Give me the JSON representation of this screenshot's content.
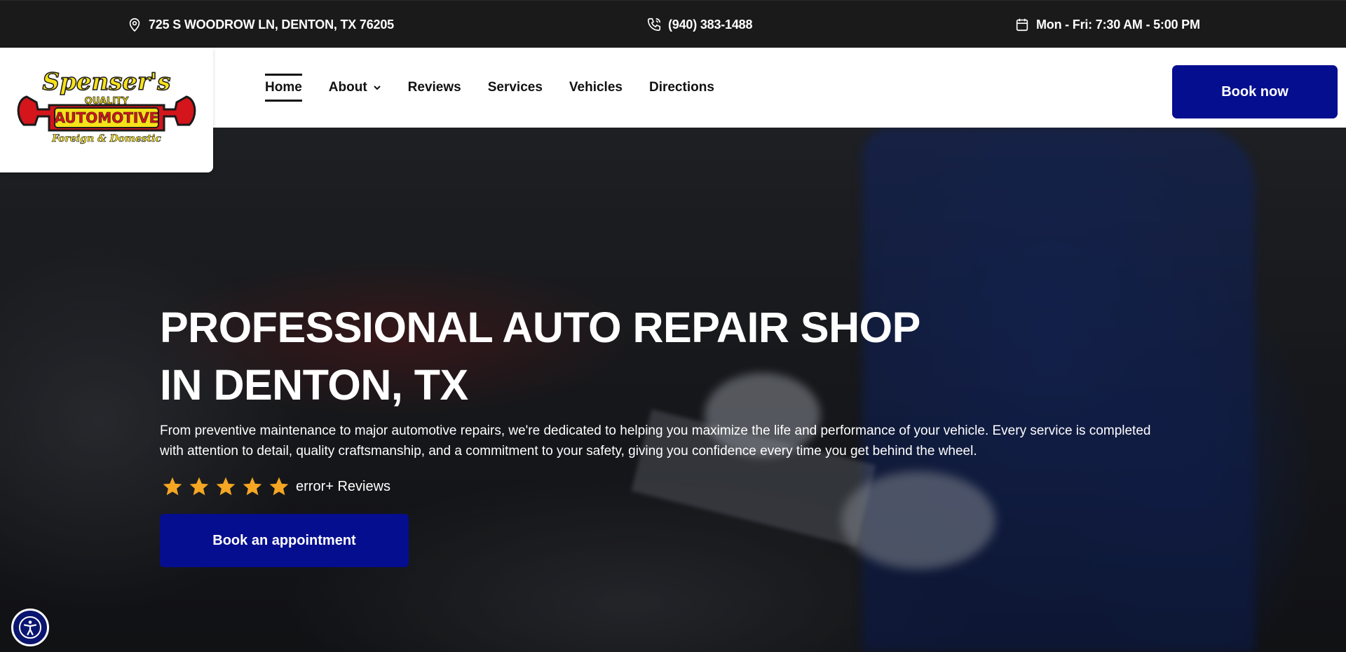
{
  "topbar": {
    "address": "725 S WOODROW LN, DENTON, TX 76205",
    "phone": "(940) 383-1488",
    "hours": "Mon - Fri: 7:30 AM - 5:00 PM"
  },
  "logo": {
    "line1": "Spenser's",
    "line2": "QUALITY",
    "line3": "AUTOMOTIVE",
    "line4": "Foreign & Domestic",
    "colors": {
      "yellow": "#f7e21a",
      "red": "#d4151c",
      "outline": "#1a1a1a"
    }
  },
  "nav": {
    "items": [
      {
        "label": "Home",
        "active": true
      },
      {
        "label": "About",
        "dropdown": true
      },
      {
        "label": "Reviews"
      },
      {
        "label": "Services"
      },
      {
        "label": "Vehicles"
      },
      {
        "label": "Directions"
      }
    ],
    "book_now": "Book now"
  },
  "hero": {
    "title_line1": "PROFESSIONAL AUTO REPAIR SHOP",
    "title_line2": "IN DENTON, TX",
    "description": "From preventive maintenance to major automotive repairs, we're dedicated to helping you maximize the life and performance of your vehicle. Every service is completed with attention to detail, quality craftsmanship, and a commitment to your safety, giving you confidence every time you get behind the wheel.",
    "rating_stars": 5,
    "reviews_label": "error+ Reviews",
    "cta": "Book an appointment"
  },
  "colors": {
    "topbar_bg": "#1a1a1a",
    "accent": "#050e8f",
    "star": "#f5a623"
  },
  "icons": [
    "location-pin-icon",
    "phone-icon",
    "calendar-icon",
    "chevron-down-icon",
    "star-icon",
    "accessibility-icon"
  ]
}
